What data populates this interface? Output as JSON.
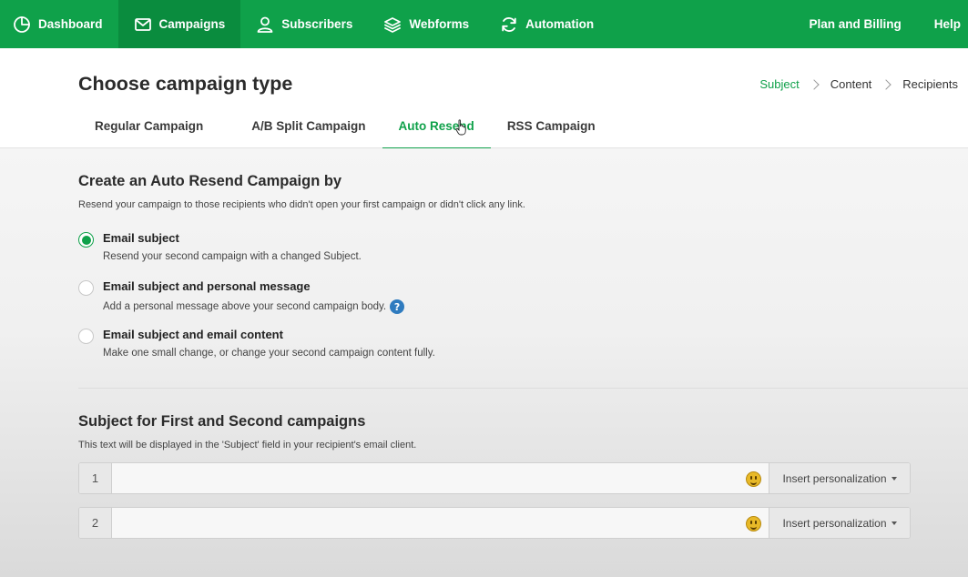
{
  "nav": {
    "items": [
      {
        "label": "Dashboard",
        "icon": "pie-chart-icon"
      },
      {
        "label": "Campaigns",
        "icon": "envelope-icon",
        "active": true
      },
      {
        "label": "Subscribers",
        "icon": "user-icon"
      },
      {
        "label": "Webforms",
        "icon": "layers-icon"
      },
      {
        "label": "Automation",
        "icon": "refresh-icon"
      }
    ],
    "right": [
      "Plan and Billing",
      "Help"
    ]
  },
  "header": {
    "title": "Choose campaign type",
    "breadcrumb": [
      "Subject",
      "Content",
      "Recipients"
    ],
    "tabs": [
      "Regular Campaign",
      "A/B Split Campaign",
      "Auto Resend",
      "RSS Campaign"
    ],
    "active_tab": "Auto Resend"
  },
  "auto_resend": {
    "title": "Create an Auto Resend Campaign by",
    "description": "Resend your campaign to those recipients who didn't open your first campaign or didn't click any link.",
    "options": [
      {
        "label": "Email subject",
        "desc": "Resend your second campaign with a changed Subject.",
        "checked": true
      },
      {
        "label": "Email subject and personal message",
        "desc": "Add a personal message above your second campaign body.",
        "checked": false
      },
      {
        "label": "Email subject and email content",
        "desc": "Make one small change, or change your second campaign content fully.",
        "checked": false
      }
    ],
    "help_glyph": "?"
  },
  "subject": {
    "title": "Subject for First and Second campaigns",
    "description": "This text will be displayed in the 'Subject' field in your recipient's email client.",
    "fields": [
      {
        "number": "1",
        "value": "",
        "personalize_label": "Insert personalization"
      },
      {
        "number": "2",
        "value": "",
        "personalize_label": "Insert personalization"
      }
    ]
  },
  "colors": {
    "brand": "#0fa14a",
    "help": "#2f7bbf"
  }
}
